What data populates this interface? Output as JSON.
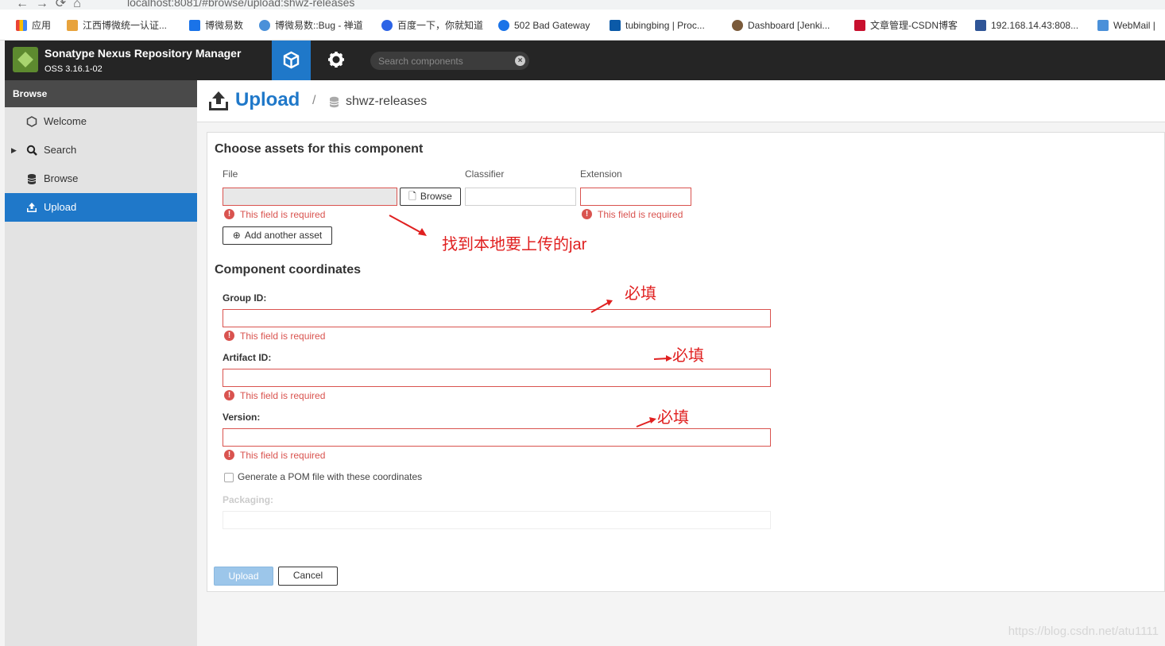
{
  "browser": {
    "address": "localhost:8081/#browse/upload:shwz-releases",
    "bookmarks": [
      {
        "label": "应用",
        "color": "#e8710a"
      },
      {
        "label": "江西博微统一认证...",
        "color": "#e8a33c"
      },
      {
        "label": "博微易数",
        "color": "#1a73e8"
      },
      {
        "label": "博微易数::Bug - 禅道",
        "color": "#4a90d9"
      },
      {
        "label": "百度一下，你就知道",
        "color": "#2d64e6"
      },
      {
        "label": "502 Bad Gateway",
        "color": "#1a73e8"
      },
      {
        "label": "tubingbing | Proc...",
        "color": "#0b5aa8"
      },
      {
        "label": "Dashboard [Jenki...",
        "color": "#7a5a3a"
      },
      {
        "label": "文章管理-CSDN博客",
        "color": "#c8102e"
      },
      {
        "label": "192.168.14.43:808...",
        "color": "#2f5597"
      },
      {
        "label": "WebMail |",
        "color": "#4a90d9"
      }
    ]
  },
  "header": {
    "app_name": "Sonatype Nexus Repository Manager",
    "version": "OSS 3.16.1-02",
    "search_placeholder": "Search components"
  },
  "sidebar": {
    "heading": "Browse",
    "items": [
      {
        "label": "Welcome",
        "icon": "hexagon-icon"
      },
      {
        "label": "Search",
        "icon": "search-icon"
      },
      {
        "label": "Browse",
        "icon": "database-icon"
      },
      {
        "label": "Upload",
        "icon": "upload-icon",
        "active": true
      }
    ]
  },
  "breadcrumb": {
    "title": "Upload",
    "separator": "/",
    "repo": "shwz-releases"
  },
  "form": {
    "assets_title": "Choose assets for this component",
    "col_file": "File",
    "col_classifier": "Classifier",
    "col_extension": "Extension",
    "browse_label": "Browse",
    "add_asset_label": "Add another asset",
    "coords_title": "Component coordinates",
    "group_label": "Group ID:",
    "artifact_label": "Artifact ID:",
    "version_label": "Version:",
    "required_msg": "This field is required",
    "pom_label": "Generate a POM file with these coordinates",
    "packaging_label": "Packaging:",
    "upload_label": "Upload",
    "cancel_label": "Cancel"
  },
  "annotations": {
    "jar_note": "找到本地要上传的jar",
    "required_note": "必填"
  },
  "watermark": "https://blog.csdn.net/atu1111"
}
